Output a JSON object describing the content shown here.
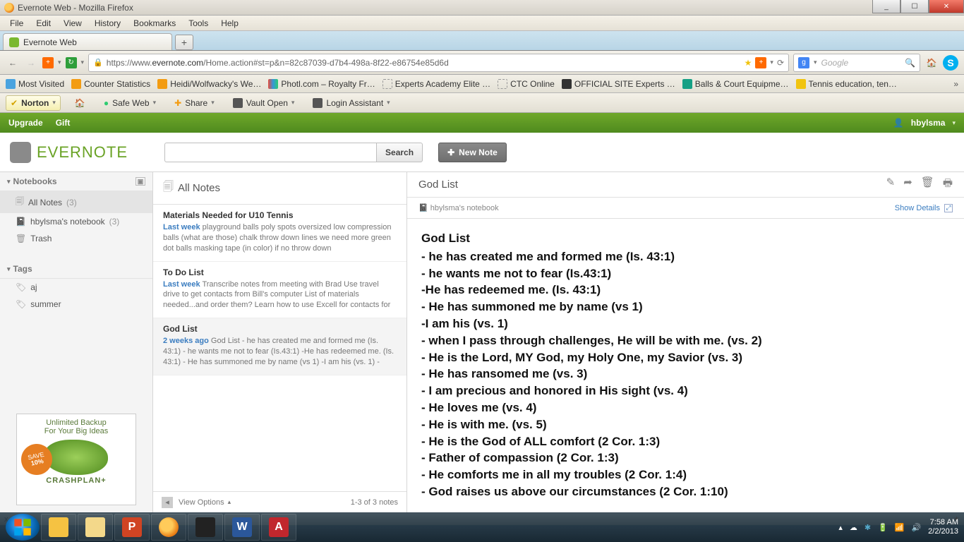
{
  "window": {
    "title": "Evernote Web - Mozilla Firefox"
  },
  "menus": {
    "file": "File",
    "edit": "Edit",
    "view": "View",
    "history": "History",
    "bookmarks": "Bookmarks",
    "tools": "Tools",
    "help": "Help"
  },
  "tab": {
    "label": "Evernote Web"
  },
  "url": {
    "host": "evernote.com",
    "pre": "https://www.",
    "path": "/Home.action#st=p&n=82c87039-d7b4-498a-8f22-e86754e85d6d"
  },
  "searchEngine": {
    "placeholder": "Google"
  },
  "bookmarks": [
    {
      "label": "Most Visited"
    },
    {
      "label": "Counter Statistics"
    },
    {
      "label": "Heidi/Wolfwacky's We…"
    },
    {
      "label": "Photl.com – Royalty Fr…"
    },
    {
      "label": "Experts Academy Elite …"
    },
    {
      "label": "CTC Online"
    },
    {
      "label": "OFFICIAL SITE Experts …"
    },
    {
      "label": "Balls & Court Equipme…"
    },
    {
      "label": "Tennis education, ten…"
    }
  ],
  "norton": {
    "brand": "Norton",
    "safe": "Safe Web",
    "share": "Share",
    "vault": "Vault Open",
    "login": "Login Assistant"
  },
  "evTop": {
    "upgrade": "Upgrade",
    "gift": "Gift",
    "user": "hbylsma"
  },
  "evHeader": {
    "brand": "EVERNOTE",
    "searchBtn": "Search",
    "newNote": "New Note"
  },
  "sidebar": {
    "sections": {
      "notebooks": "Notebooks",
      "tags": "Tags"
    },
    "items": {
      "allNotes": "All Notes",
      "allNotesCount": "(3)",
      "userNb": "hbylsma's notebook",
      "userNbCount": "(3)",
      "trash": "Trash"
    },
    "tags": [
      "aj",
      "summer"
    ],
    "ad": {
      "line1": "Unlimited Backup",
      "line2": "For Your Big Ideas",
      "save": "SAVE",
      "pct": "10%",
      "brand": "CRASHPLAN+"
    }
  },
  "noteList": {
    "header": "All Notes",
    "items": [
      {
        "title": "Materials Needed for U10 Tennis",
        "age": "Last week",
        "snippet": "playground balls poly spots oversized low compression balls (what are those) chalk throw down lines we need more green dot balls masking tape (in color) if no throw down"
      },
      {
        "title": "To Do List",
        "age": "Last week",
        "snippet": "Transcribe notes from meeting with Brad Use travel drive to get contacts from Bill's computer List of materials needed...and order them? Learn how to use Excell for contacts for"
      },
      {
        "title": "God List",
        "age": "2 weeks ago",
        "snippet": "God List - he has created me and formed me (Is. 43:1) - he wants me not to fear (Is.43:1) -He has redeemed me. (Is. 43:1) - He has summoned me by name (vs 1) -I am his (vs. 1) -"
      }
    ],
    "viewOptions": "View Options",
    "count": "1-3 of 3 notes"
  },
  "note": {
    "title": "God List",
    "notebook": "hbylsma's notebook",
    "showDetails": "Show Details",
    "body": [
      "God List",
      "- he has created me and formed me (Is. 43:1)",
      "- he wants me not to fear (Is.43:1)",
      "-He has redeemed me. (Is. 43:1)",
      "- He has summoned me by name (vs 1)",
      "-I am his (vs. 1)",
      "- when I pass through challenges, He will be with me. (vs. 2)",
      "- He is the Lord, MY God, my Holy One, my Savior (vs. 3)",
      "-  He has ransomed me (vs. 3)",
      "-  I am precious and honored in His sight (vs. 4)",
      "-  He loves me (vs. 4)",
      "-  He is with me. (vs. 5)",
      "-  He is the God of ALL comfort (2 Cor. 1:3)",
      "-  Father of compassion  (2 Cor. 1:3)",
      "-  He comforts me in all my troubles  (2 Cor. 1:4)",
      "-  God raises us above our circumstances  (2 Cor. 1:10)"
    ]
  },
  "status": {
    "x": "x"
  },
  "tray": {
    "time": "7:58 AM",
    "date": "2/2/2013"
  }
}
